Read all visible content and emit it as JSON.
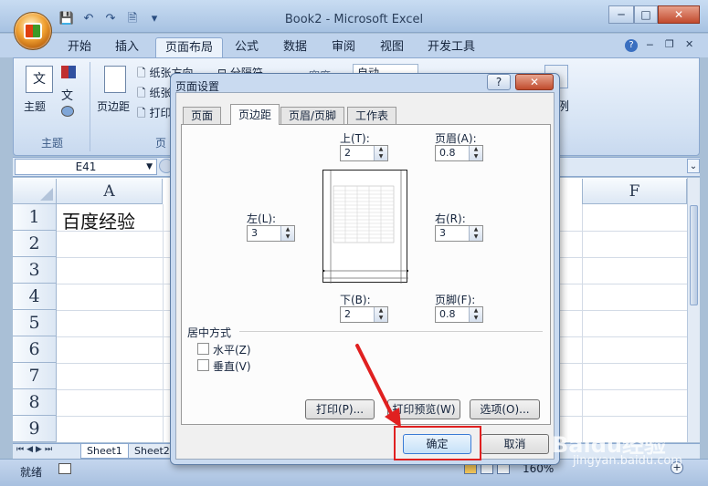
{
  "window": {
    "title": "Book2 - Microsoft Excel",
    "min_label": "─",
    "max_label": "□",
    "close_label": "✕"
  },
  "ribbon_tabs": [
    "开始",
    "插入",
    "页面布局",
    "公式",
    "数据",
    "审阅",
    "视图",
    "开发工具"
  ],
  "ribbon": {
    "theme_group_label": "主题",
    "themes_button": "主题",
    "margins_button": "页边距",
    "orientation_button": "纸张方向",
    "size_button": "纸张",
    "print_area_button": "打印",
    "breaks_button": "分隔符",
    "page_setup_group_clip": "页",
    "theme_icon_text": "文",
    "dim_width_label": "宽度",
    "dim_width_value": "自动",
    "scale_clip": "例"
  },
  "namebox": {
    "value": "E41"
  },
  "sheet": {
    "columns": [
      "A",
      "F"
    ],
    "rows": [
      "1",
      "2",
      "3",
      "4",
      "5",
      "6",
      "7",
      "8",
      "9"
    ],
    "cell_a1": "百度经验",
    "tabs": [
      "Sheet1",
      "Sheet2"
    ]
  },
  "status": {
    "ready": "就绪",
    "zoom": "160%"
  },
  "dialog": {
    "title": "页面设置",
    "help": "?",
    "close": "✕",
    "tabs": [
      "页面",
      "页边距",
      "页眉/页脚",
      "工作表"
    ],
    "top_label": "上(T):",
    "top_value": "2",
    "header_label": "页眉(A):",
    "header_value": "0.8",
    "left_label": "左(L):",
    "left_value": "3",
    "right_label": "右(R):",
    "right_value": "3",
    "bottom_label": "下(B):",
    "bottom_value": "2",
    "footer_label": "页脚(F):",
    "footer_value": "0.8",
    "center_group": "居中方式",
    "horizontal": "水平(Z)",
    "horizontal_checked": false,
    "vertical": "垂直(V)",
    "vertical_checked": false,
    "print_button": "打印(P)...",
    "preview_button": "打印预览(W)",
    "options_button": "选项(O)...",
    "ok_button": "确定",
    "cancel_button": "取消"
  },
  "annotation": {
    "color": "#e02020"
  },
  "watermark": {
    "text": "Baidu经验",
    "url": "jingyan.baidu.com"
  }
}
